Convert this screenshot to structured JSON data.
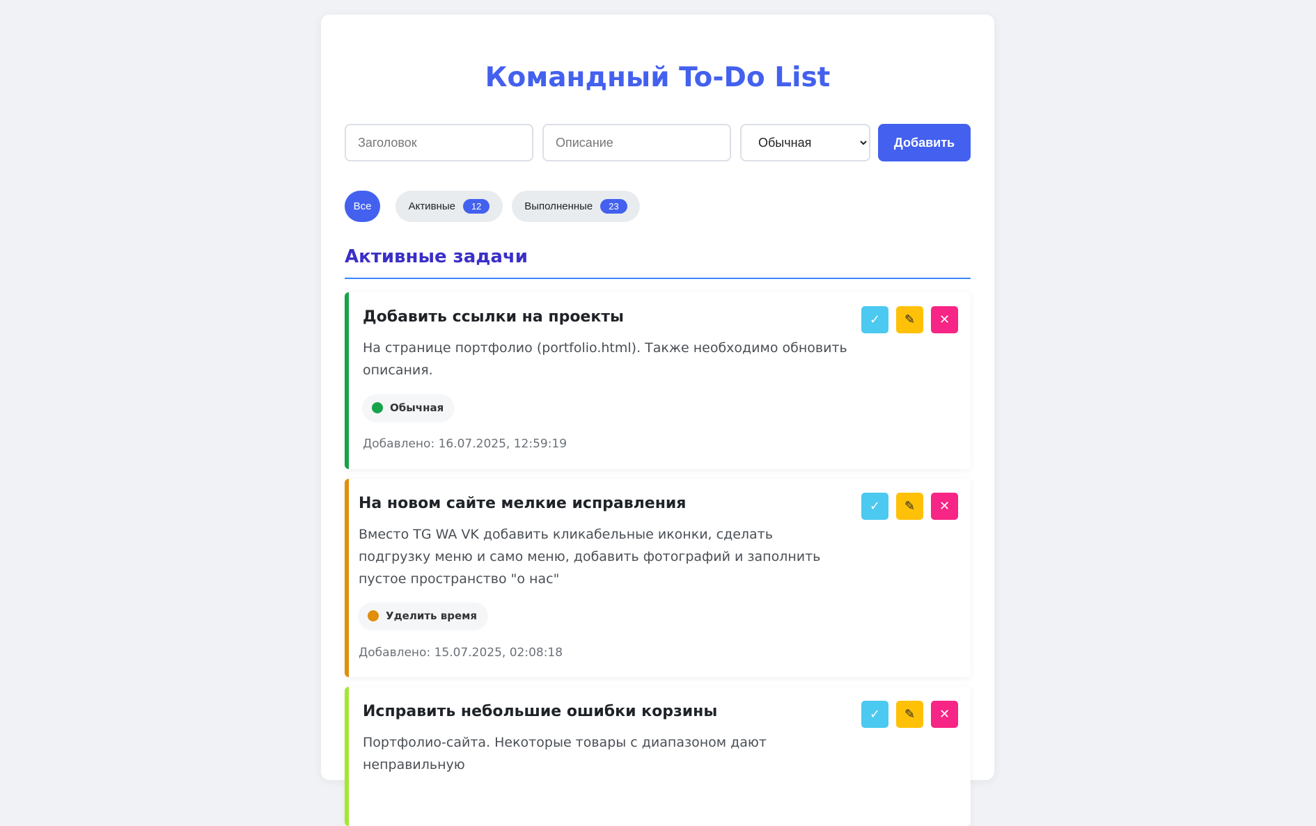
{
  "app": {
    "title": "Командный To-Do List"
  },
  "form": {
    "title_placeholder": "Заголовок",
    "description_placeholder": "Описание",
    "priority_selected": "Обычная",
    "add_label": "Добавить"
  },
  "filters": [
    {
      "label": "Все",
      "active": true
    },
    {
      "label": "Активные",
      "count": "12",
      "active": false
    },
    {
      "label": "Выполненные",
      "count": "23",
      "active": false
    }
  ],
  "section": {
    "title": "Активные задачи"
  },
  "actions": {
    "complete_icon": "✓",
    "edit_icon": "✎",
    "delete_icon": "✕"
  },
  "tasks": [
    {
      "title": "Добавить ссылки на проекты",
      "description": "На странице портфолио (portfolio.html). Также необходимо обновить описания.",
      "priority": "Обычная",
      "priority_color": "#16a34a",
      "added": "Добавлено: 16.07.2025, 12:59:19"
    },
    {
      "title": "На новом сайте мелкие исправления",
      "description": "Вместо TG WA VK добавить кликабельные иконки, сделать подгрузку меню и само меню, добавить фотографий и заполнить пустое пространство \"о нас\"",
      "priority": "Уделить время",
      "priority_color": "#e08e0b",
      "added": "Добавлено: 15.07.2025, 02:08:18"
    },
    {
      "title": "Исправить небольшие ошибки корзины",
      "description": "Портфолио-сайта. Некоторые товары с диапазоном дают неправильную",
      "priority_color": "#a3e635"
    }
  ]
}
